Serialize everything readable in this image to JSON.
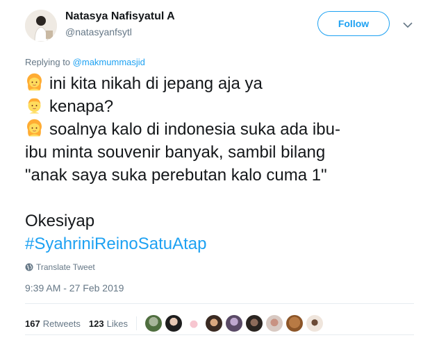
{
  "author": {
    "name": "Natasya Nafisyatul A",
    "handle": "@natasyanfsytl"
  },
  "follow_label": "Follow",
  "reply": {
    "prefix": "Replying to",
    "mention": "@makmummasjid"
  },
  "tweet": {
    "line1": "ini kita nikah di jepang aja ya",
    "line2": "kenapa?",
    "line3": "soalnya kalo di indonesia suka ada ibu-",
    "line4": "ibu minta souvenir banyak, sambil bilang",
    "line5": "\"anak saya suka perebutan kalo cuma 1\"",
    "line6": "Okesiyap",
    "hashtag": "#SyahriniReinoSatuAtap"
  },
  "translate_label": "Translate Tweet",
  "timestamp": "9:39 AM - 27 Feb 2019",
  "stats": {
    "retweets_count": "167",
    "retweets_label": "Retweets",
    "likes_count": "123",
    "likes_label": "Likes"
  },
  "icons": {
    "woman": "woman-emoji-icon",
    "man": "man-emoji-icon",
    "globe": "globe-icon",
    "chevron": "chevron-down-icon"
  },
  "colors": {
    "accent": "#1da1f2",
    "secondary_text": "#657786",
    "primary_text": "#14171a",
    "divider": "#e6ecf0"
  }
}
